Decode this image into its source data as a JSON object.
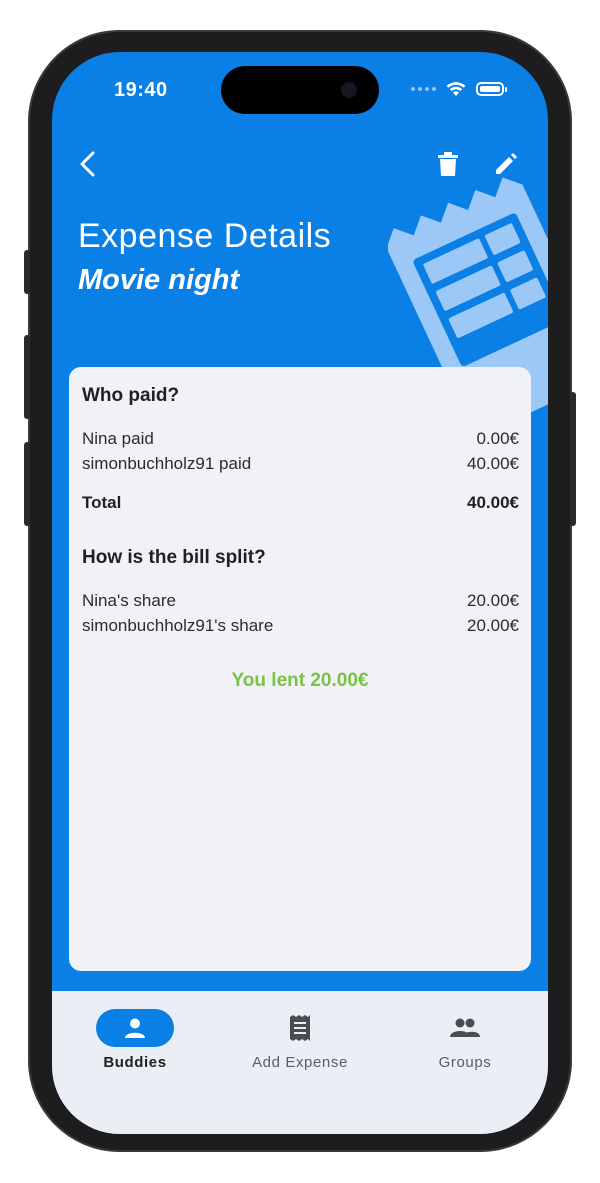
{
  "status_bar": {
    "time": "19:40"
  },
  "header": {
    "title": "Expense Details",
    "subtitle": "Movie night",
    "back_icon": "back-arrow-icon",
    "delete_icon": "trash-icon",
    "edit_icon": "pencil-icon"
  },
  "who_paid": {
    "heading": "Who paid?",
    "rows": [
      {
        "label": "Nina paid",
        "amount": "0.00€"
      },
      {
        "label": "simonbuchholz91 paid",
        "amount": "40.00€"
      }
    ],
    "total_label": "Total",
    "total_amount": "40.00€"
  },
  "split": {
    "heading": "How is the bill split?",
    "rows": [
      {
        "label": "Nina's share",
        "amount": "20.00€"
      },
      {
        "label": "simonbuchholz91's share",
        "amount": "20.00€"
      }
    ]
  },
  "summary": {
    "text": "You lent 20.00€",
    "color": "#7cc246"
  },
  "bottom_nav": {
    "items": [
      {
        "label": "Buddies",
        "icon": "person-icon",
        "active": true
      },
      {
        "label": "Add Expense",
        "icon": "receipt-icon",
        "active": false
      },
      {
        "label": "Groups",
        "icon": "group-icon",
        "active": false
      }
    ]
  },
  "colors": {
    "primary": "#0a7fe6",
    "card": "#f0f2f7",
    "nav_bg": "#eceef5"
  }
}
